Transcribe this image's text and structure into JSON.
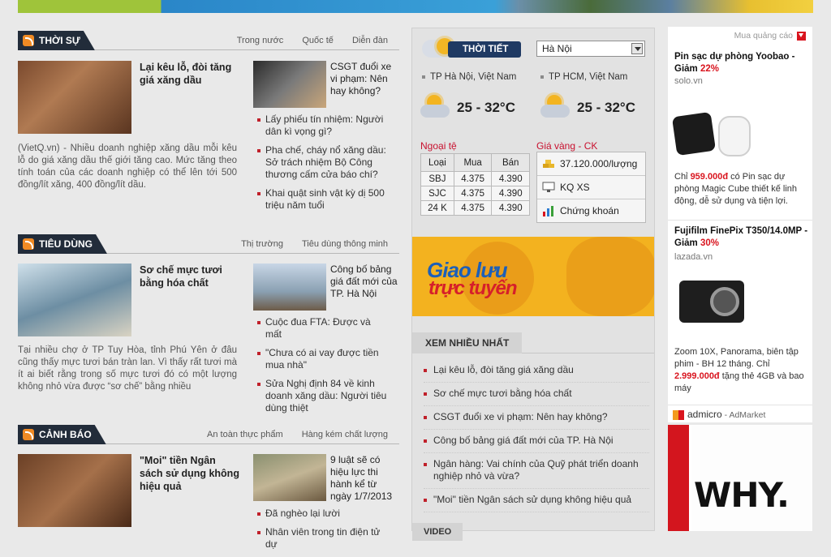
{
  "sections": [
    {
      "title": "THỜI SỰ",
      "sublinks": [
        "Trong nước",
        "Quốc tế",
        "Diễn đàn"
      ],
      "headline": "Lại kêu lỗ, đòi tăng giá xăng dầu",
      "summary": "(VietQ.vn) - Nhiều doanh nghiệp xăng dầu mỗi kêu lỗ do giá xăng dầu thế giới tăng cao. Mức tăng theo tính toán của các doanh nghiệp có thể lên tới 500 đồng/lít xăng, 400 đồng/lít dầu.",
      "side_title": "CSGT đuổi xe vi phạm: Nên hay không?",
      "bullets": [
        "Lấy phiếu tín nhiệm: Người dân kì vọng gì?",
        "Pha chế, cháy nổ xăng dầu: Sở trách nhiệm Bộ Công thương cấm cửa báo chí?",
        "Khai quật sinh vật kỳ dị 500 triệu năm tuổi"
      ]
    },
    {
      "title": "TIÊU DÙNG",
      "sublinks": [
        "Thị trường",
        "Tiêu dùng thông minh"
      ],
      "headline": "Sơ chế mực tươi bằng hóa chất",
      "summary": "Tại nhiều chợ ở TP Tuy Hòa, tỉnh Phú Yên ở đâu cũng thấy mực tươi bán tràn lan. Vì thấy rất tươi mà ít ai biết rằng trong số mực tươi đó có một lượng không nhỏ vừa được “sơ chế” bằng nhiều",
      "side_title": "Công bố bảng giá đất mới của TP. Hà Nội",
      "bullets": [
        "Cuộc đua FTA: Được và mất",
        "\"Chưa có ai vay được tiền mua nhà\"",
        "Sửa Nghị định 84 về kinh doanh xăng dầu: Người tiêu dùng thiệt"
      ]
    },
    {
      "title": "CẢNH BÁO",
      "sublinks": [
        "An toàn thực phẩm",
        "Hàng kém chất lượng"
      ],
      "headline": "\"Moi\" tiền Ngân sách sử dụng không hiệu quả",
      "side_title": "9 luật sẽ có hiệu lực thi hành kể từ ngày 1/7/2013",
      "bullets": [
        "Đã nghèo lại lười",
        "Nhân viên trong tin điện tử dự"
      ]
    }
  ],
  "weather": {
    "label": "THỜI TIẾT",
    "selected_city": "Hà Nội",
    "cities": [
      {
        "name": "TP Hà Nội, Việt Nam",
        "temp": "25 - 32°C"
      },
      {
        "name": "TP HCM, Việt Nam",
        "temp": "25 - 32°C"
      }
    ]
  },
  "forex": {
    "label": "Ngoại tệ",
    "headers": [
      "Loại",
      "Mua",
      "Bán"
    ],
    "rows": [
      [
        "SBJ",
        "4.375",
        "4.390"
      ],
      [
        "SJC",
        "4.375",
        "4.390"
      ],
      [
        "24 K",
        "4.375",
        "4.390"
      ]
    ]
  },
  "gold": {
    "label": "Giá vàng - CK",
    "rows": [
      "37.120.000/lượng",
      "KQ XS",
      "Chứng khoán"
    ]
  },
  "banner": {
    "line1": "Giao lưu",
    "line2": "trực tuyến"
  },
  "most_viewed": {
    "label": "XEM NHIỀU NHẤT",
    "items": [
      "Lại kêu lỗ, đòi tăng giá xăng dầu",
      "Sơ chế mực tươi bằng hóa chất",
      "CSGT đuổi xe vi phạm: Nên hay không?",
      "Công bố bảng giá đất mới của TP. Hà Nội",
      "Ngân hàng: Vai chính của Quỹ phát triển doanh nghiệp nhỏ và vừa?",
      "\"Moi\" tiền Ngân sách sử dụng không hiệu quả"
    ]
  },
  "video": {
    "label": "VIDEO"
  },
  "ads": {
    "top_label": "Mua quảng cáo",
    "items": [
      {
        "title": "Pin sạc dự phòng Yoobao - Giảm ",
        "pct": "22%",
        "source": "solo.vn",
        "desc_pre": "Chỉ ",
        "price": "959.000đ",
        "desc_post": " có Pin sạc dự phòng Magic Cube thiết kế linh động, dễ sử dụng và tiện lợi."
      },
      {
        "title": "Fujifilm FinePix T350/14.0MP - Giảm ",
        "pct": "30%",
        "source": "lazada.vn",
        "desc_pre": "Zoom 10X, Panorama, biên tập phim - BH 12 tháng. Chỉ ",
        "price": "2.999.000đ",
        "desc_post": " tặng thẻ 4GB và bao máy"
      }
    ],
    "network": "admicro",
    "network_sub": " - AdMarket"
  },
  "why_banner": {
    "text": "WHY."
  }
}
